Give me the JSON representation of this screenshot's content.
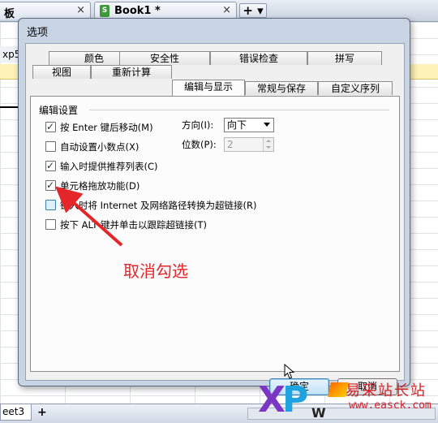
{
  "app": {
    "tabs": [
      {
        "label": "板",
        "close": "×"
      },
      {
        "label": "Book1 *",
        "close": "×"
      }
    ],
    "doc_icon": "S",
    "add_tab_label": "+ ▾",
    "fx_text": "xp5",
    "sheet_tab": "eet3",
    "sheet_add": "+"
  },
  "dialog": {
    "title": "选项",
    "tabs_row1": [
      "颜色",
      "安全性",
      "错误检查",
      "拼写"
    ],
    "tabs_row2": [
      "视图",
      "重新计算",
      "编辑与显示",
      "常规与保存",
      "自定义序列"
    ],
    "active_tab": "编辑与显示",
    "group_title": "编辑设置",
    "options": [
      {
        "label": "按 Enter 键后移动(M)",
        "checked": true
      },
      {
        "label": "自动设置小数点(X)",
        "checked": false
      },
      {
        "label": "输入时提供推荐列表(C)",
        "checked": true
      },
      {
        "label": "单元格拖放功能(D)",
        "checked": true
      },
      {
        "label": "键入时将 Internet 及网络路径转换为超链接(R)",
        "checked": false
      },
      {
        "label": "按下 ALT 键并单击以跟踪超链接(T)",
        "checked": false
      }
    ],
    "direction_label": "方向(I):",
    "direction_value": "向下",
    "places_label": "位数(P):",
    "places_value": "2",
    "ok_label": "确定",
    "cancel_label": "取消"
  },
  "annotation": {
    "text": "取消勾选",
    "color": "#e2262a"
  },
  "watermark": {
    "logo_x": "X",
    "logo_p": "P",
    "site_name": "易采站长站",
    "url": "www.easck.com",
    "w": "W"
  },
  "icons": {
    "checkbox_check": "check-icon",
    "select_arrow": "chevron-down-icon",
    "spin": "spinner-arrows-icon",
    "cursor": "mouse-pointer-icon",
    "arrow": "red-arrow-annotation"
  }
}
